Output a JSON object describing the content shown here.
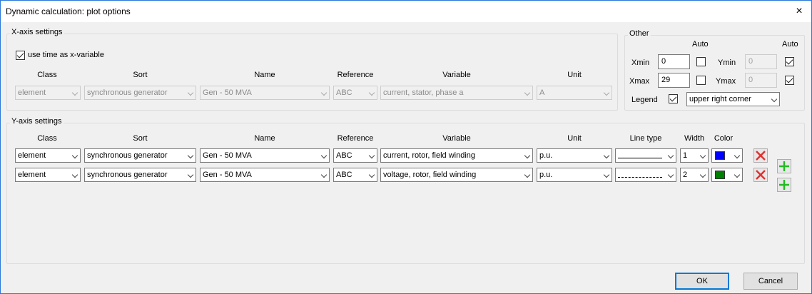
{
  "window": {
    "title": "Dynamic calculation: plot options",
    "close_glyph": "×"
  },
  "x_axis": {
    "group_label": "X-axis settings",
    "use_time_label": "use time as x-variable",
    "use_time_checked": true,
    "headers": {
      "class": "Class",
      "sort": "Sort",
      "name": "Name",
      "reference": "Reference",
      "variable": "Variable",
      "unit": "Unit"
    },
    "row": {
      "class": "element",
      "sort": "synchronous generator",
      "name": "Gen - 50 MVA",
      "reference": "ABC",
      "variable": "current, stator, phase a",
      "unit": "A"
    }
  },
  "other": {
    "group_label": "Other",
    "auto_label": "Auto",
    "xmin_label": "Xmin",
    "xmin_value": "0",
    "xmin_auto": false,
    "xmax_label": "Xmax",
    "xmax_value": "29",
    "xmax_auto": false,
    "ymin_label": "Ymin",
    "ymin_value": "0",
    "ymin_auto": true,
    "ymax_label": "Ymax",
    "ymax_value": "0",
    "ymax_auto": true,
    "legend_label": "Legend",
    "legend_checked": true,
    "legend_position": "upper right corner"
  },
  "y_axis": {
    "group_label": "Y-axis settings",
    "headers": {
      "class": "Class",
      "sort": "Sort",
      "name": "Name",
      "reference": "Reference",
      "variable": "Variable",
      "unit": "Unit",
      "line_type": "Line type",
      "width": "Width",
      "color": "Color"
    },
    "rows": [
      {
        "class": "element",
        "sort": "synchronous generator",
        "name": "Gen - 50 MVA",
        "reference": "ABC",
        "variable": "current, rotor, field winding",
        "unit": "p.u.",
        "line_style": "solid",
        "width": "1",
        "color": "#0000ff"
      },
      {
        "class": "element",
        "sort": "synchronous generator",
        "name": "Gen - 50 MVA",
        "reference": "ABC",
        "variable": "voltage, rotor, field winding",
        "unit": "p.u.",
        "line_style": "dashed",
        "width": "2",
        "color": "#008000"
      }
    ]
  },
  "buttons": {
    "ok": "OK",
    "cancel": "Cancel"
  },
  "colors": {
    "delete": "#e03030",
    "add": "#22bb22",
    "accent": "#0078d7"
  }
}
